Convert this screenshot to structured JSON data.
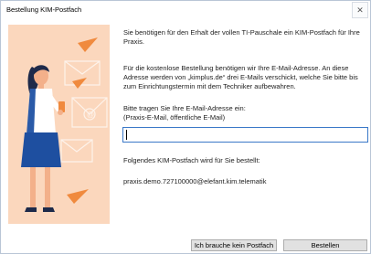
{
  "window": {
    "title": "Bestellung KIM-Postfach",
    "close_glyph": "✕"
  },
  "content": {
    "intro": "Sie benötigen für den Erhalt der vollen TI-Pauschale ein KIM-Postfach für Ihre Praxis.",
    "info": "Für die kostenlose Bestellung benötigen wir Ihre E-Mail-Adresse. An diese Adresse werden von „kimplus.de“ drei E-Mails verschickt, welche Sie bitte bis zum Einrichtungstermin mit dem Techniker aufbewahren.",
    "prompt_line1": "Bitte tragen Sie Ihre E-Mail-Adresse ein:",
    "prompt_line2": "(Praxis-E-Mail, öffentliche E-Mail)",
    "email_value": "",
    "following_label": "Folgendes KIM-Postfach wird für Sie bestellt:",
    "kim_address": "praxis.demo.727100000@elefant.kim.telematik"
  },
  "buttons": {
    "no_need_label": "Ich brauche kein Postfach",
    "order_label": "Bestellen"
  },
  "colors": {
    "illustration_bg": "#fbd7bd",
    "accent_orange": "#f08a3e",
    "input_border": "#3a78c8"
  },
  "icons": [
    "close-icon",
    "envelope-icon",
    "paper-plane-icon",
    "woman-with-phone-illustration"
  ]
}
